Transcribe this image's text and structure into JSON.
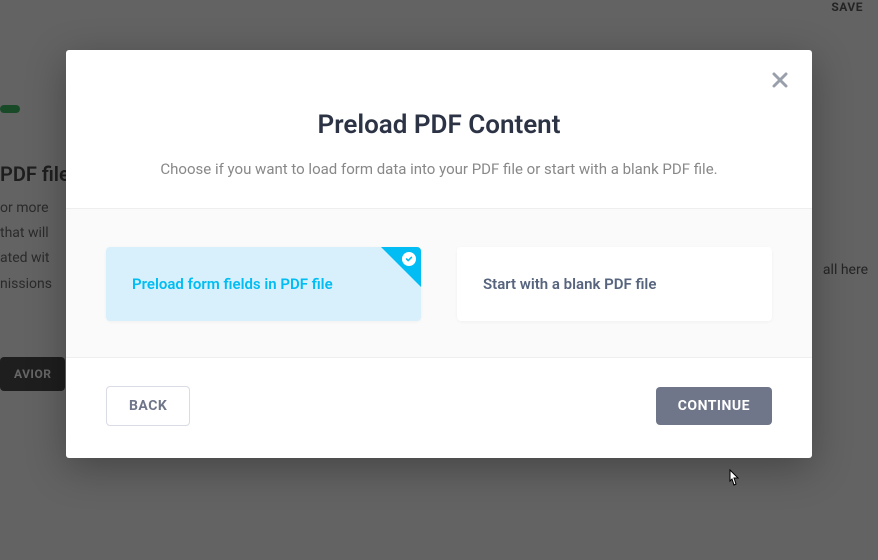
{
  "background": {
    "save_label": "SAVE",
    "heading_fragment": "PDF file",
    "right_fragment": "all here",
    "button_label": "AVIOR"
  },
  "modal": {
    "title": "Preload PDF Content",
    "subtitle": "Choose if you want to load form data into your PDF file or start with a blank PDF file.",
    "options": {
      "preload": {
        "label": "Preload form fields in PDF file",
        "selected": true
      },
      "blank": {
        "label": "Start with a blank PDF file",
        "selected": false
      }
    },
    "back_label": "BACK",
    "continue_label": "CONTINUE"
  }
}
